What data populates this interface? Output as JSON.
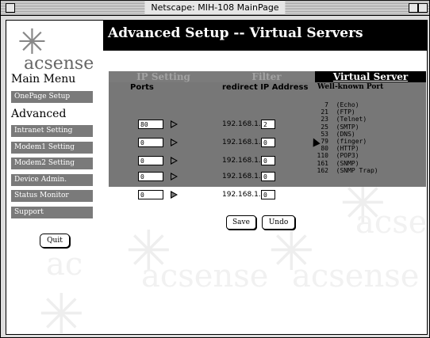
{
  "window": {
    "title": "Netscape: MIH-108 MainPage"
  },
  "sidebar": {
    "logo_text": "acsense",
    "main_menu_label": "Main Menu",
    "advanced_label": "Advanced",
    "items": [
      {
        "label": "OnePage Setup"
      },
      {
        "label": "Intranet Setting"
      },
      {
        "label": "Modem1 Setting"
      },
      {
        "label": "Modem2 Setting"
      },
      {
        "label": "Device Admin."
      },
      {
        "label": "Status Monitor"
      },
      {
        "label": "Support"
      }
    ],
    "quit_label": "Quit"
  },
  "header": {
    "title": "Advanced Setup -- Virtual Servers"
  },
  "tabs": [
    {
      "label": "IP Setting",
      "active": false
    },
    {
      "label": "Filter",
      "active": false
    },
    {
      "label": "Virtual Server",
      "active": true
    }
  ],
  "columns": {
    "ports": "Ports",
    "redirect": "redirect IP Address",
    "wellknown": "Well-known Port"
  },
  "rows": [
    {
      "port": "80",
      "ip_prefix": "192.168.1.",
      "ip_last": "2"
    },
    {
      "port": "0",
      "ip_prefix": "192.168.1.",
      "ip_last": "0"
    },
    {
      "port": "0",
      "ip_prefix": "192.168.1.",
      "ip_last": "0"
    },
    {
      "port": "0",
      "ip_prefix": "192.168.1.",
      "ip_last": "0"
    },
    {
      "port": "0",
      "ip_prefix": "192.168.1.",
      "ip_last": "0"
    }
  ],
  "wellknown_ports": [
    {
      "port": "7",
      "name": "(Echo)"
    },
    {
      "port": "21",
      "name": "(FTP)"
    },
    {
      "port": "23",
      "name": "(Telnet)"
    },
    {
      "port": "25",
      "name": "(SMTP)"
    },
    {
      "port": "53",
      "name": "(DNS)"
    },
    {
      "port": "79",
      "name": "(finger)"
    },
    {
      "port": "80",
      "name": "(HTTP)"
    },
    {
      "port": "110",
      "name": "(POP3)"
    },
    {
      "port": "161",
      "name": "(SNMP)"
    },
    {
      "port": "162",
      "name": "(SNMP Trap)"
    }
  ],
  "actions": {
    "save_label": "Save",
    "undo_label": "Undo"
  },
  "colors": {
    "header_bg": "#000000",
    "panel_bg": "#777777",
    "nav_bg": "#7a7a7a",
    "active_tab_text": "#ffffff"
  }
}
